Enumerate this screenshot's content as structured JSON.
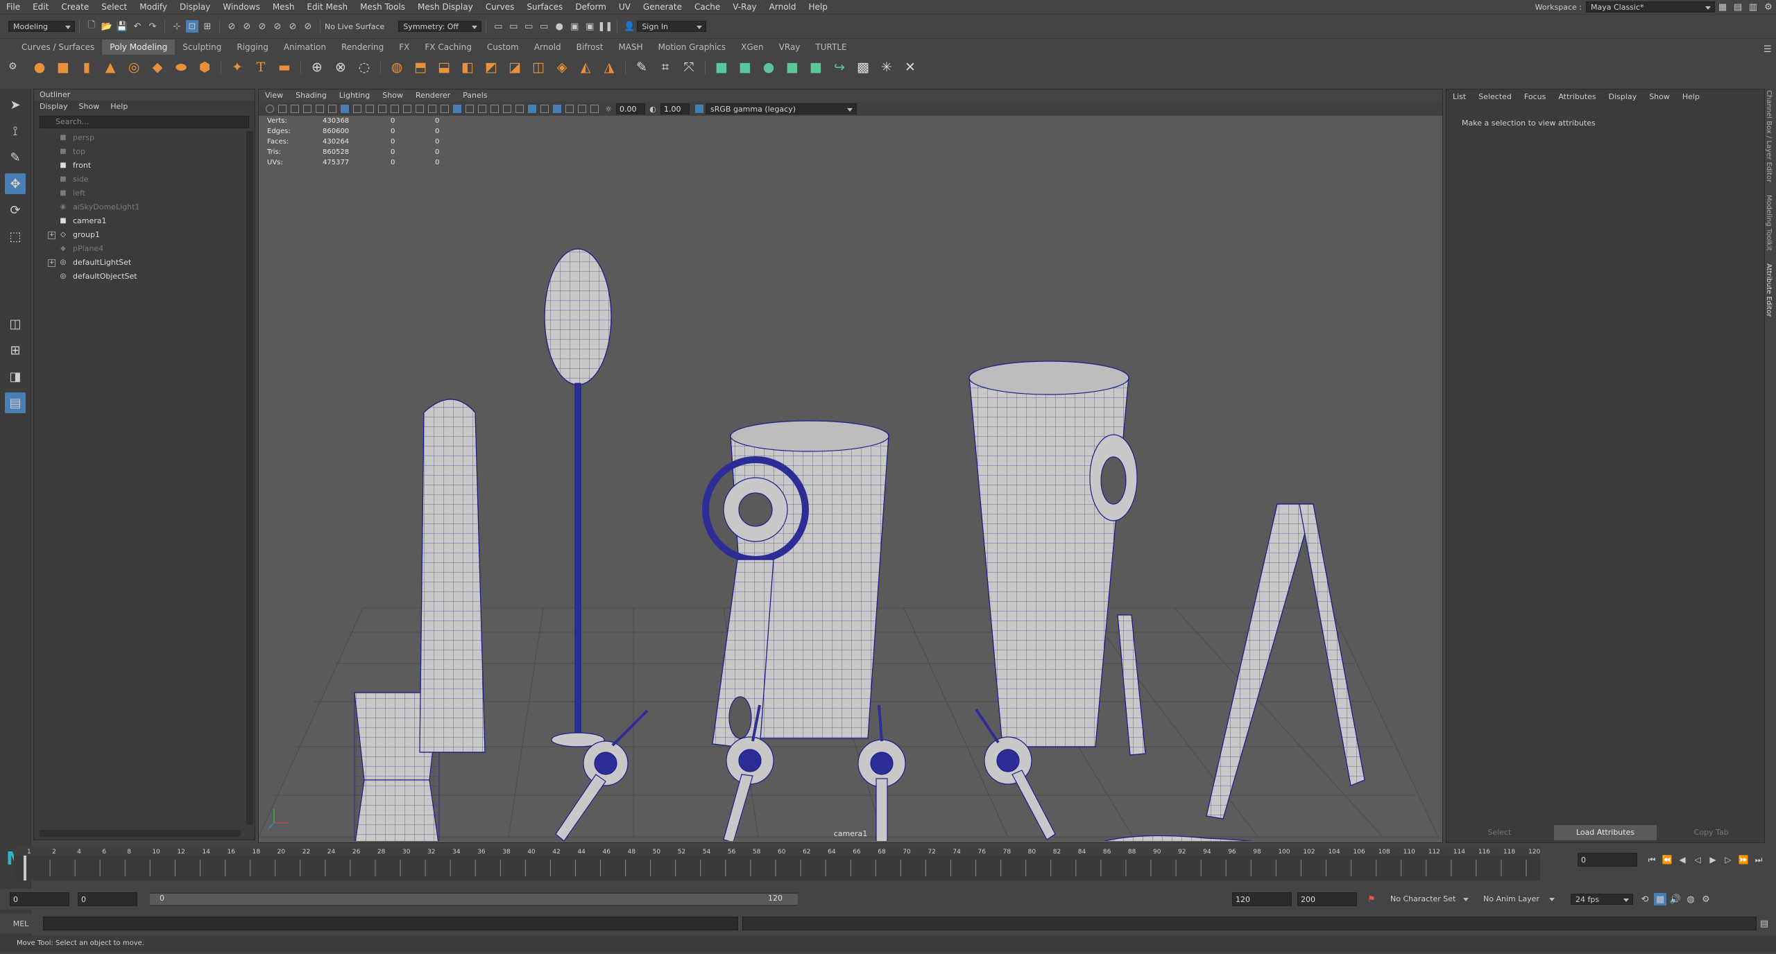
{
  "menubar": {
    "items": [
      "File",
      "Edit",
      "Create",
      "Select",
      "Modify",
      "Display",
      "Windows",
      "Mesh",
      "Edit Mesh",
      "Mesh Tools",
      "Mesh Display",
      "Curves",
      "Surfaces",
      "Deform",
      "UV",
      "Generate",
      "Cache",
      "V-Ray",
      "Arnold",
      "Help"
    ],
    "workspace_label": "Workspace :",
    "workspace_value": "Maya Classic*"
  },
  "statusline": {
    "mode": "Modeling",
    "live_surface": "No Live Surface",
    "symmetry": "Symmetry: Off",
    "sign_in": "Sign In"
  },
  "shelf": {
    "tabs": [
      "Curves / Surfaces",
      "Poly Modeling",
      "Sculpting",
      "Rigging",
      "Animation",
      "Rendering",
      "FX",
      "FX Caching",
      "Custom",
      "Arnold",
      "Bifrost",
      "MASH",
      "Motion Graphics",
      "XGen",
      "VRay",
      "TURTLE"
    ],
    "active_tab": "Poly Modeling"
  },
  "outliner": {
    "title": "Outliner",
    "menu": [
      "Display",
      "Show",
      "Help"
    ],
    "search_placeholder": "Search...",
    "items": [
      {
        "label": "persp",
        "dim": true,
        "icon": "camera-icon"
      },
      {
        "label": "top",
        "dim": true,
        "icon": "camera-icon"
      },
      {
        "label": "front",
        "dim": false,
        "icon": "camera-icon"
      },
      {
        "label": "side",
        "dim": true,
        "icon": "camera-icon"
      },
      {
        "label": "left",
        "dim": true,
        "icon": "camera-icon"
      },
      {
        "label": "aiSkyDomeLight1",
        "dim": true,
        "icon": "light-icon"
      },
      {
        "label": "camera1",
        "dim": false,
        "icon": "camera-icon"
      },
      {
        "label": "group1",
        "dim": false,
        "icon": "group-icon",
        "expandable": true
      },
      {
        "label": "pPlane4",
        "dim": true,
        "icon": "mesh-icon"
      },
      {
        "label": "defaultLightSet",
        "dim": false,
        "icon": "set-icon",
        "expandable": true
      },
      {
        "label": "defaultObjectSet",
        "dim": false,
        "icon": "set-icon"
      }
    ]
  },
  "viewport": {
    "menu": [
      "View",
      "Shading",
      "Lighting",
      "Show",
      "Renderer",
      "Panels"
    ],
    "exposure": "0.00",
    "gamma": "1.00",
    "color_space": "sRGB gamma (legacy)",
    "camera_label": "camera1",
    "hud": [
      {
        "label": "Verts:",
        "v1": "430368",
        "v2": "0",
        "v3": "0"
      },
      {
        "label": "Edges:",
        "v1": "860600",
        "v2": "0",
        "v3": "0"
      },
      {
        "label": "Faces:",
        "v1": "430264",
        "v2": "0",
        "v3": "0"
      },
      {
        "label": "Tris:",
        "v1": "860528",
        "v2": "0",
        "v3": "0"
      },
      {
        "label": "UVs:",
        "v1": "475377",
        "v2": "0",
        "v3": "0"
      }
    ]
  },
  "attribute_editor": {
    "menu": [
      "List",
      "Selected",
      "Focus",
      "Attributes",
      "Display",
      "Show",
      "Help"
    ],
    "message": "Make a selection to view attributes",
    "buttons": [
      "Select",
      "Load Attributes",
      "Copy Tab"
    ],
    "side_tabs": [
      "Channel Box / Layer Editor",
      "Modeling Toolkit",
      "Attribute Editor"
    ]
  },
  "timeslider": {
    "ticks": [
      "1",
      "2",
      "4",
      "6",
      "8",
      "10",
      "12",
      "14",
      "16",
      "18",
      "20",
      "22",
      "24",
      "26",
      "28",
      "30",
      "32",
      "34",
      "36",
      "38",
      "40",
      "42",
      "44",
      "46",
      "48",
      "50",
      "52",
      "54",
      "56",
      "58",
      "60",
      "62",
      "64",
      "66",
      "68",
      "70",
      "72",
      "74",
      "76",
      "78",
      "80",
      "82",
      "84",
      "86",
      "88",
      "90",
      "92",
      "94",
      "96",
      "98",
      "100",
      "102",
      "104",
      "106",
      "108",
      "110",
      "112",
      "114",
      "116",
      "118",
      "120"
    ],
    "current_frame": "0"
  },
  "range": {
    "start": "0",
    "anim_start": "0",
    "slider_start": "0",
    "slider_end": "120",
    "anim_end": "120",
    "end": "200",
    "character_set": "No Character Set",
    "anim_layer": "No Anim Layer",
    "fps": "24 fps"
  },
  "cmdline": {
    "label": "MEL"
  },
  "helpline": {
    "text": "Move Tool: Select an object to move."
  }
}
